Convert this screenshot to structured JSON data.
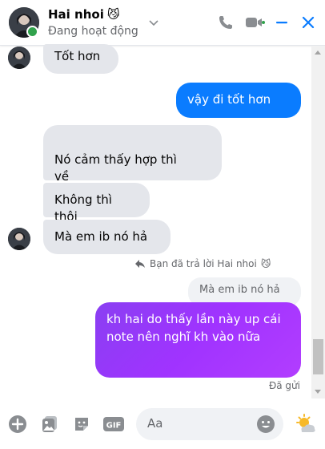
{
  "header": {
    "name": "Hai nhoi",
    "name_emoji": "😼",
    "status": "Đang hoạt động",
    "icons": [
      "chevron-down-icon",
      "phone-icon",
      "video-icon",
      "minimize-icon",
      "close-icon"
    ]
  },
  "messages": [
    {
      "from": "them",
      "text": "Tốt hơn"
    },
    {
      "from": "me",
      "text": "vậy đi tốt hơn"
    },
    {
      "from": "them",
      "text": "Nó cảm thấy hợp thì\nvề"
    },
    {
      "from": "them",
      "text": "Không thì thôi"
    },
    {
      "from": "them",
      "text": "Mà em ib nó hả"
    }
  ],
  "reply": {
    "note": "Bạn đã trả lời Hai nhoi",
    "note_emoji": "😼",
    "quoted": "Mà em ib nó hả",
    "text": "kh hai do thấy lần này up cái note nên nghĩ kh vào nữa",
    "sent_status": "Đã gửi"
  },
  "composer": {
    "placeholder": "Aa",
    "icons": [
      "plus-icon",
      "image-icon",
      "sticker-icon",
      "gif-icon",
      "emoji-icon",
      "quick-reaction-icon"
    ]
  },
  "colors": {
    "accent": "#0a7cff",
    "reply_gradient": "#a033ff",
    "incoming_bg": "#e4e6eb",
    "online": "#31a24c"
  }
}
